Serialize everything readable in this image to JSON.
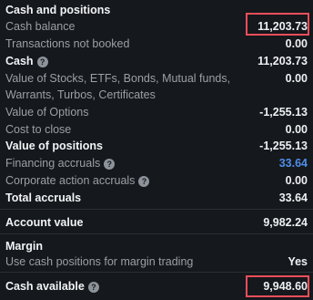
{
  "section": {
    "title": "Cash and positions",
    "margin_title": "Margin"
  },
  "rows": {
    "cash_balance": {
      "label": "Cash balance",
      "value": "11,203.73"
    },
    "transactions_not_booked": {
      "label": "Transactions not booked",
      "value": "0.00"
    },
    "cash": {
      "label": "Cash",
      "value": "11,203.73"
    },
    "value_of_stocks": {
      "label_line1": "Value of Stocks, ETFs, Bonds, Mutual funds,",
      "label_line2": "Warrants, Turbos, Certificates",
      "value": "0.00"
    },
    "value_of_options": {
      "label": "Value of Options",
      "value": "-1,255.13"
    },
    "cost_to_close": {
      "label": "Cost to close",
      "value": "0.00"
    },
    "value_of_positions": {
      "label": "Value of positions",
      "value": "-1,255.13"
    },
    "financing_accruals": {
      "label": "Financing accruals",
      "value": "33.64"
    },
    "corporate_action_accruals": {
      "label": "Corporate action accruals",
      "value": "0.00"
    },
    "total_accruals": {
      "label": "Total accruals",
      "value": "33.64"
    },
    "account_value": {
      "label": "Account value",
      "value": "9,982.24"
    },
    "use_cash_positions": {
      "label": "Use cash positions for margin trading",
      "value": "Yes"
    },
    "cash_available": {
      "label": "Cash available",
      "value": "9,948.60"
    }
  },
  "icons": {
    "info_glyph": "?"
  },
  "colors": {
    "background": "#15181c",
    "highlight": "#ef4e5a",
    "link": "#4f8ee8"
  }
}
